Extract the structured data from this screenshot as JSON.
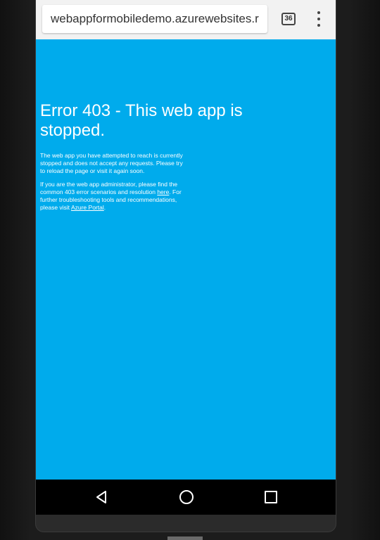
{
  "browser": {
    "url": "webappformobiledemo.azurewebsites.r",
    "tab_count": "36"
  },
  "page": {
    "title": "Error 403 - This web app is stopped.",
    "paragraph1": "The web app you have attempted to reach is currently stopped and does not accept any requests. Please try to reload the page or visit it again soon.",
    "paragraph2_before_link": "If you are the web app administrator, please find the common 403 error scenarios and resolution ",
    "here_link": "here",
    "paragraph2_middle": ". For further troubleshooting tools and recommendations, please visit ",
    "portal_link": "Azure Portal",
    "paragraph2_end": "."
  },
  "icons": {
    "tab_switcher": "tab-switcher-icon",
    "menu": "more-vert-icon",
    "back": "back-triangle-icon",
    "home": "home-circle-icon",
    "recent": "recent-apps-square-icon"
  },
  "colors": {
    "page_background": "#00abec",
    "text": "#ffffff",
    "browser_bar": "#f2f2f2",
    "nav_bar": "#000000"
  }
}
